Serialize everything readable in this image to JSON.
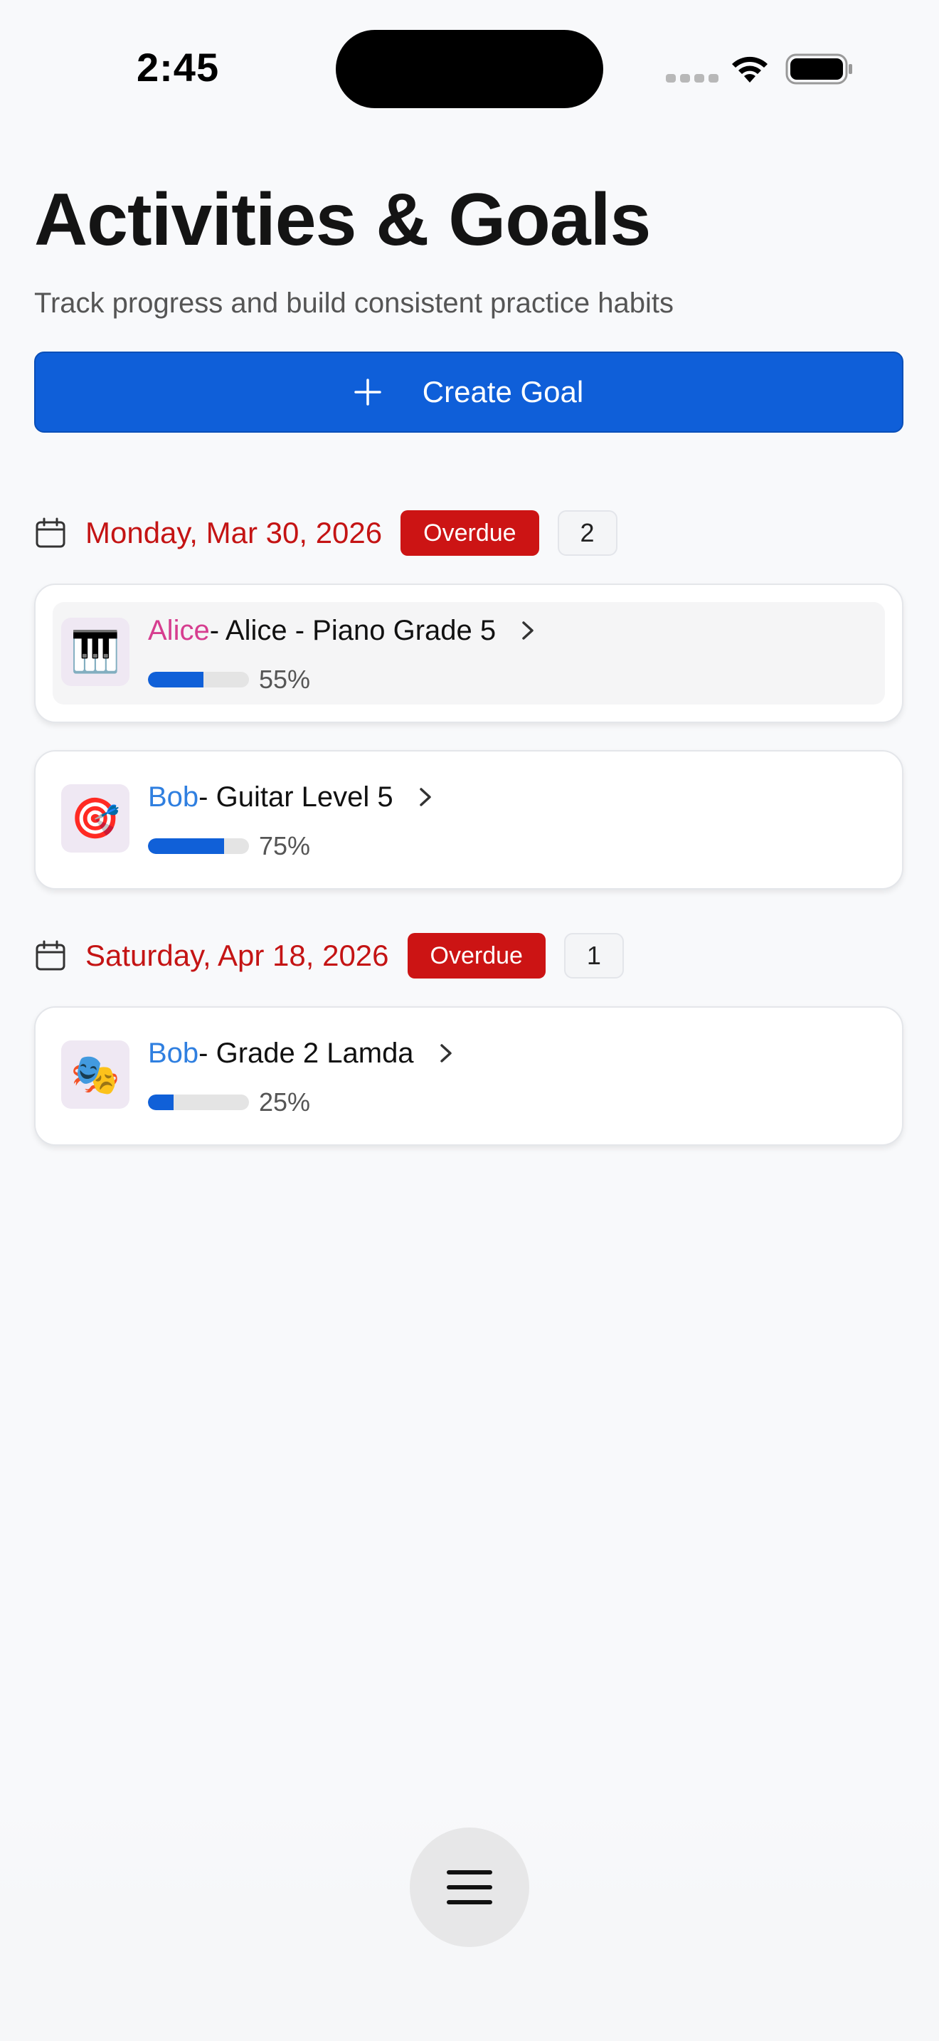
{
  "status_bar": {
    "time": "2:45"
  },
  "header": {
    "title": "Activities & Goals",
    "subtitle": "Track progress and build consistent practice habits"
  },
  "create_button": {
    "label": "Create Goal",
    "icon": "plus-icon"
  },
  "colors": {
    "accent": "#0f5fd9",
    "overdue": "#cc1414",
    "alice": "#d63d8f",
    "bob": "#2f7fe0"
  },
  "sections": [
    {
      "date": "Monday, Mar 30, 2026",
      "status": "Overdue",
      "count": "2",
      "goals": [
        {
          "icon": "🎹",
          "owner": "Alice",
          "title": " - Alice - Piano Grade 5",
          "progress": 55,
          "progress_label": "55%"
        },
        {
          "icon": "🎯",
          "owner": "Bob",
          "title": " - Guitar Level 5",
          "progress": 75,
          "progress_label": "75%"
        }
      ]
    },
    {
      "date": "Saturday, Apr 18, 2026",
      "status": "Overdue",
      "count": "1",
      "goals": [
        {
          "icon": "🎭",
          "owner": "Bob",
          "title": " - Grade 2 Lamda",
          "progress": 25,
          "progress_label": "25%"
        }
      ]
    }
  ],
  "menu": {
    "icon": "hamburger-menu-icon"
  }
}
